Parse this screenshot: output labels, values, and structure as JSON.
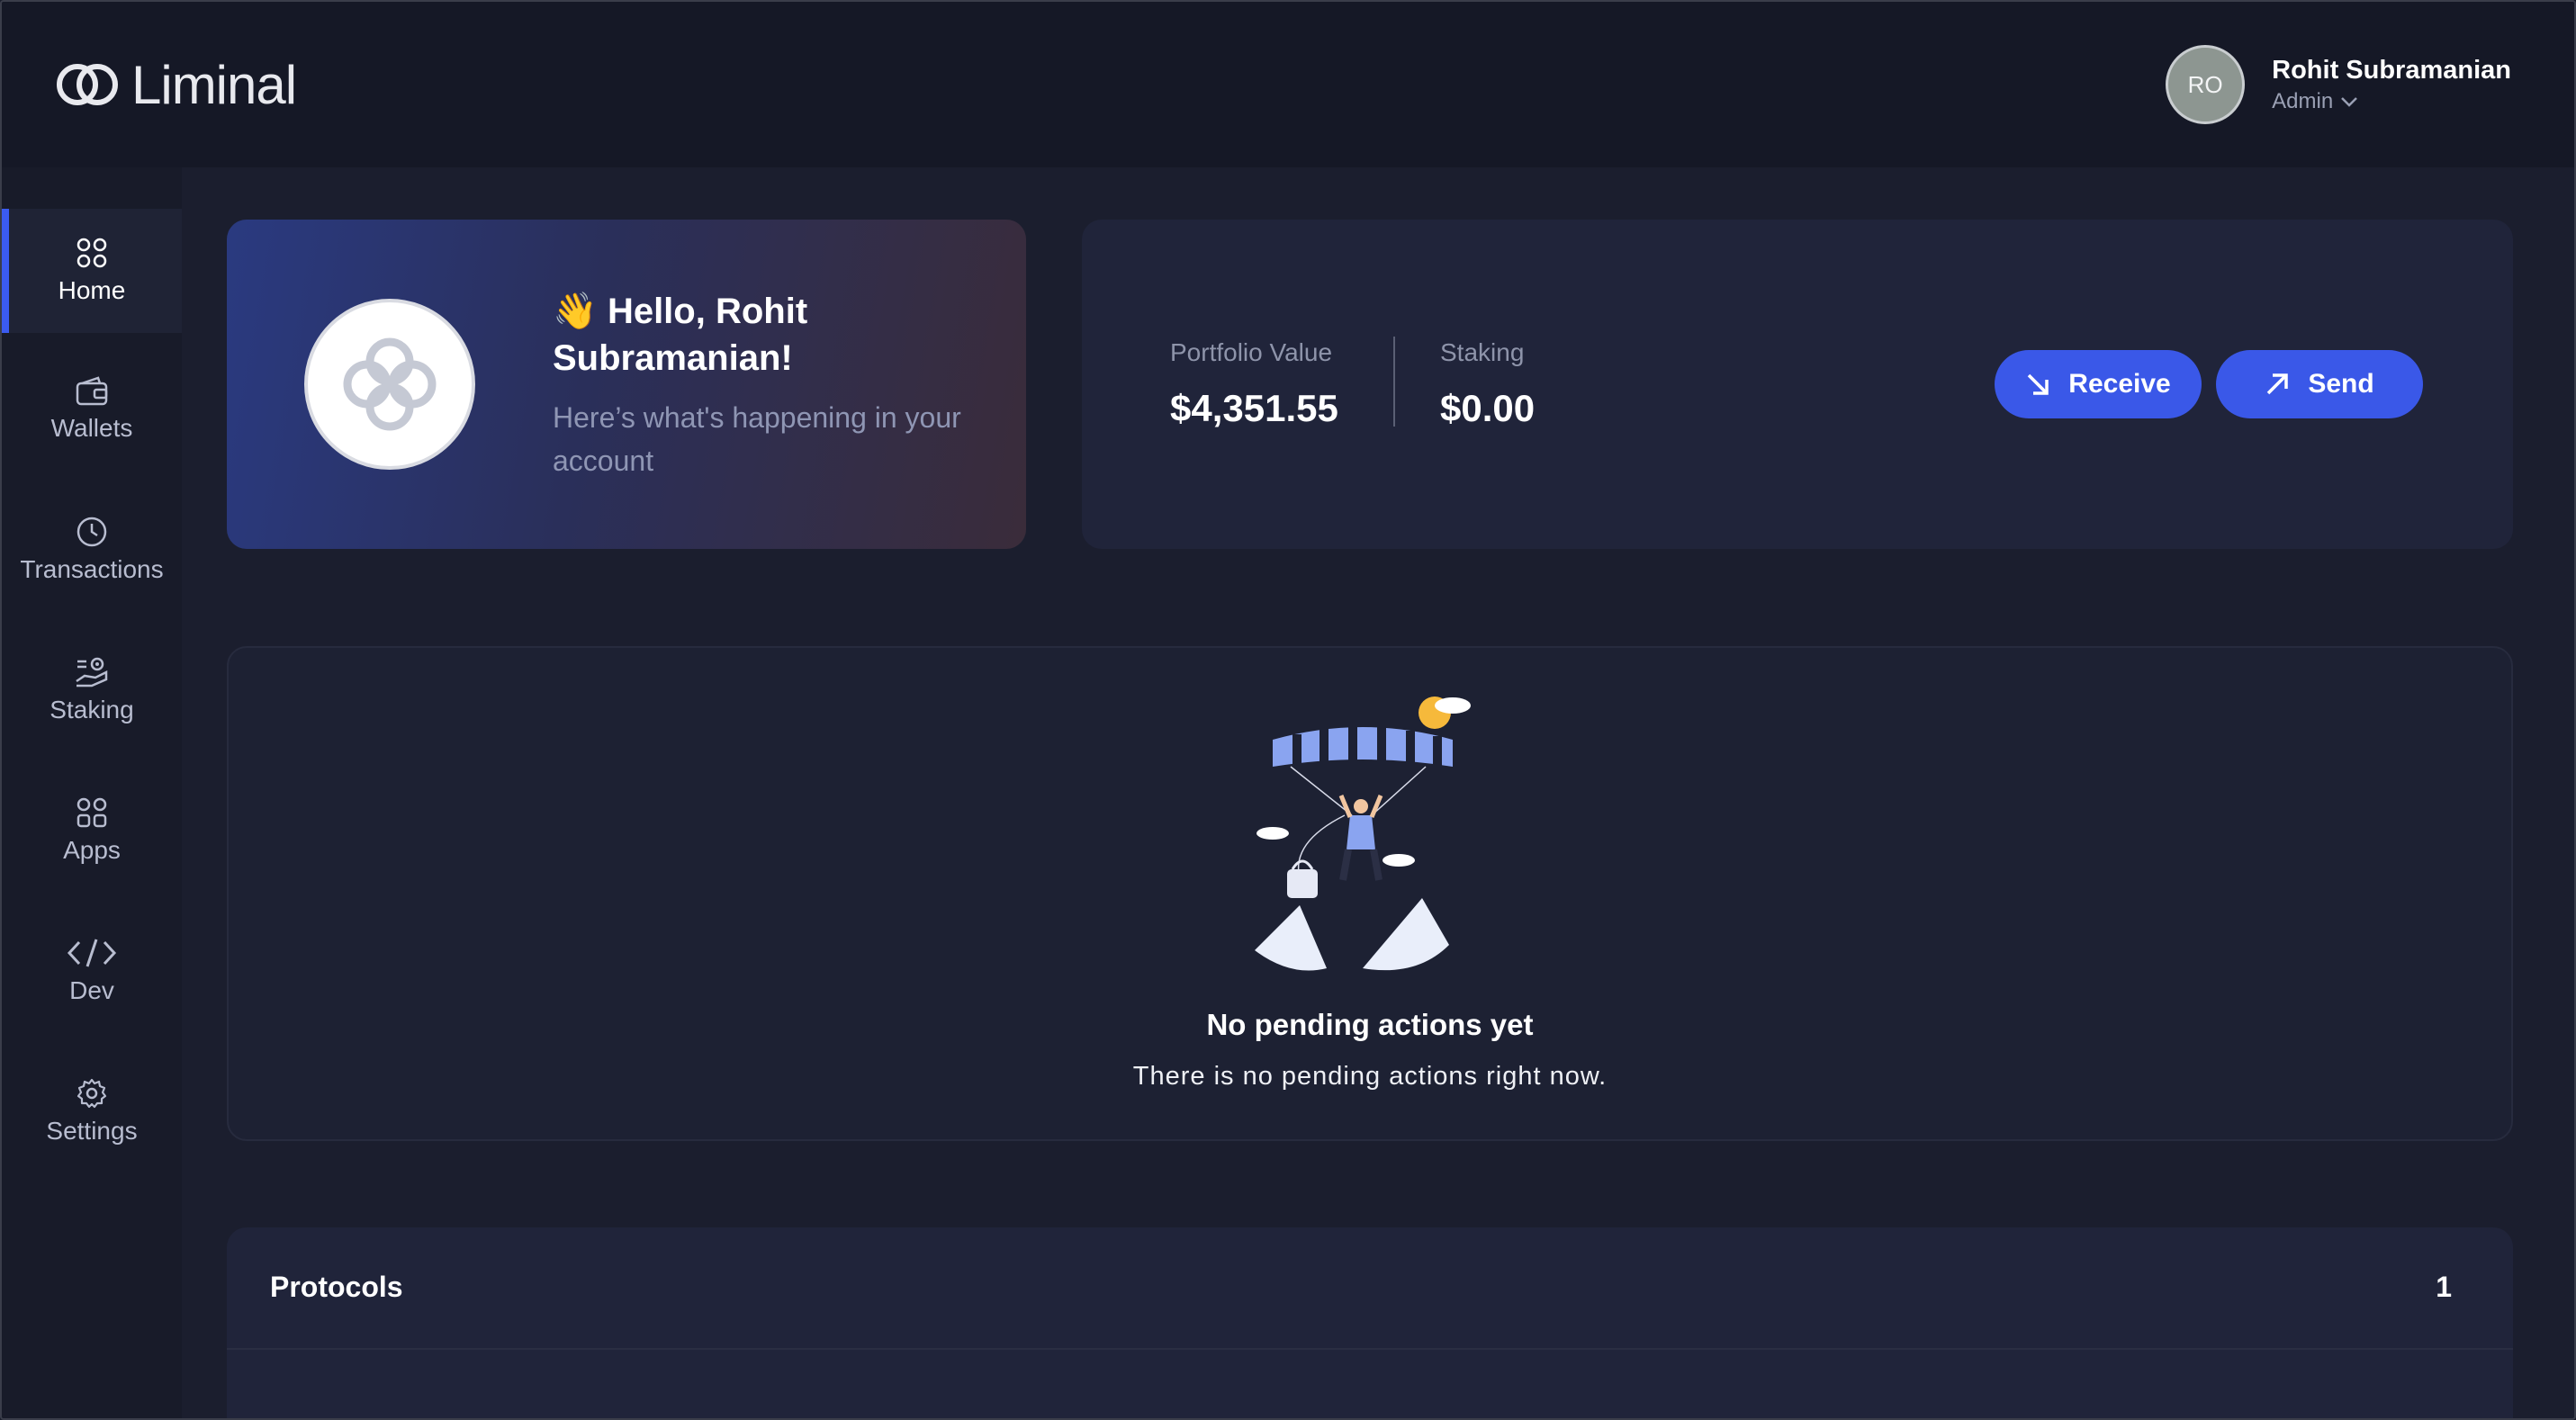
{
  "app": {
    "brand": "Liminal"
  },
  "user": {
    "initials": "RO",
    "name": "Rohit Subramanian",
    "role": "Admin"
  },
  "sidebar": {
    "items": [
      {
        "label": "Home",
        "icon": "home-grid-icon",
        "active": true
      },
      {
        "label": "Wallets",
        "icon": "wallet-icon",
        "active": false
      },
      {
        "label": "Transactions",
        "icon": "clock-icon",
        "active": false
      },
      {
        "label": "Staking",
        "icon": "staking-hand-icon",
        "active": false
      },
      {
        "label": "Apps",
        "icon": "apps-grid-icon",
        "active": false
      },
      {
        "label": "Dev",
        "icon": "code-icon",
        "active": false
      },
      {
        "label": "Settings",
        "icon": "gear-icon",
        "active": false
      }
    ]
  },
  "greeting": {
    "emoji": "👋",
    "title": "Hello, Rohit Subramanian!",
    "subtitle": "Here’s what's happening in your account"
  },
  "portfolio": {
    "value_label": "Portfolio Value",
    "value": "$4,351.55",
    "staking_label": "Staking",
    "staking_value": "$0.00",
    "receive_label": "Receive",
    "send_label": "Send"
  },
  "pending": {
    "title": "No pending actions yet",
    "subtitle": "There is no pending actions right now."
  },
  "protocols": {
    "title": "Protocols",
    "count": "1"
  },
  "colors": {
    "accent": "#3a58e8",
    "background": "#1b1e2e",
    "card": "#20243a"
  }
}
